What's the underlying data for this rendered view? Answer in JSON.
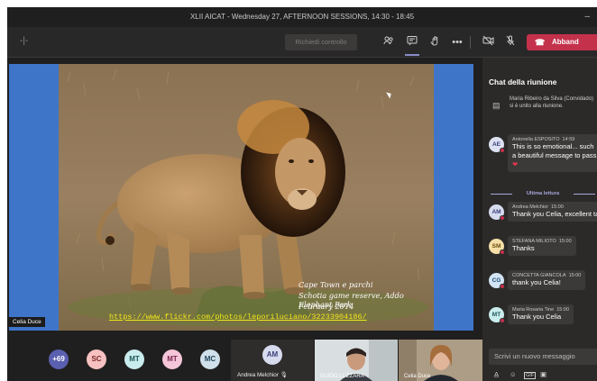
{
  "window": {
    "title": "XLII AICAT - Wednesday 27, AFTERNOON SESSIONS, 14:30 - 18:45",
    "minimize": "–"
  },
  "toolbar": {
    "timer_icon": "-|-",
    "request_control": "Richiedi controllo",
    "hangup_label": "Abband",
    "hangup_icon": "☎",
    "hangup_color": "#c4314b",
    "icons": [
      "participants-icon",
      "chat-icon",
      "raise-hand-icon",
      "more-icon",
      "camera-off-icon",
      "mic-off-icon",
      "share-icon"
    ]
  },
  "stage": {
    "presenter": "Celia Duce",
    "share_background": "#3f75c9",
    "caption_lines": [
      "Cape Town e parchi",
      "Schotia game reserve, Addo Elephant Park",
      "February 2014"
    ],
    "photo_link": "https://www.flickr.com/photos/leporiluciano/32233904186/"
  },
  "participants": {
    "overflow": "+69",
    "avatars": [
      {
        "initials": "SC",
        "bg": "#f7c1c1",
        "fg": "#7a2a2a"
      },
      {
        "initials": "MT",
        "bg": "#c9ecec",
        "fg": "#1e5656"
      },
      {
        "initials": "MT",
        "bg": "#f5c6d8",
        "fg": "#7b2750"
      },
      {
        "initials": "MC",
        "bg": "#cfe0ea",
        "fg": "#24475c"
      }
    ],
    "active_speaker": {
      "initials": "AM",
      "name": "Andrea Melchior"
    },
    "video_tiles": [
      "GUIDO LUZZARA",
      "Celia Duce"
    ]
  },
  "chat": {
    "title": "Chat della riunione",
    "join_notice": "Maria Ribeiro da Silva (Convidado) si è unito alla riunione.",
    "messages": [
      {
        "initials": "AE",
        "author": "Antonella ESPOSITO",
        "time": "14:59",
        "text": "This is so emotional... such a beautiful message to pass on...",
        "extra": "❤",
        "bg": "#dde1f2",
        "fg": "#3a3f7a"
      },
      {
        "initials": "AM",
        "author": "Andrea Melchior",
        "time": "15:00",
        "text": "Thank you Celia, excellent talk!",
        "bg": "#d7dbee",
        "fg": "#3a3f7a"
      },
      {
        "initials": "SM",
        "author": "STEFANA MILIOTO",
        "time": "15:00",
        "text": "Thanks",
        "bg": "#f5dfa6",
        "fg": "#6b4e0e"
      },
      {
        "initials": "CG",
        "author": "CONCETTA GIANCOLA",
        "time": "15:00",
        "text": "thank you Celia!",
        "bg": "#d2e4f4",
        "fg": "#1f4a70"
      },
      {
        "initials": "MT",
        "author": "Maria Rosaria Tine",
        "time": "15:00",
        "text": "Thank you Celia",
        "bg": "#c9ecec",
        "fg": "#1e5656"
      }
    ],
    "last_read": "Ultima lettura",
    "compose_placeholder": "Scrivi un nuovo messaggio",
    "format_icons": [
      "A̲",
      "☺",
      "GIF",
      "▣"
    ]
  }
}
